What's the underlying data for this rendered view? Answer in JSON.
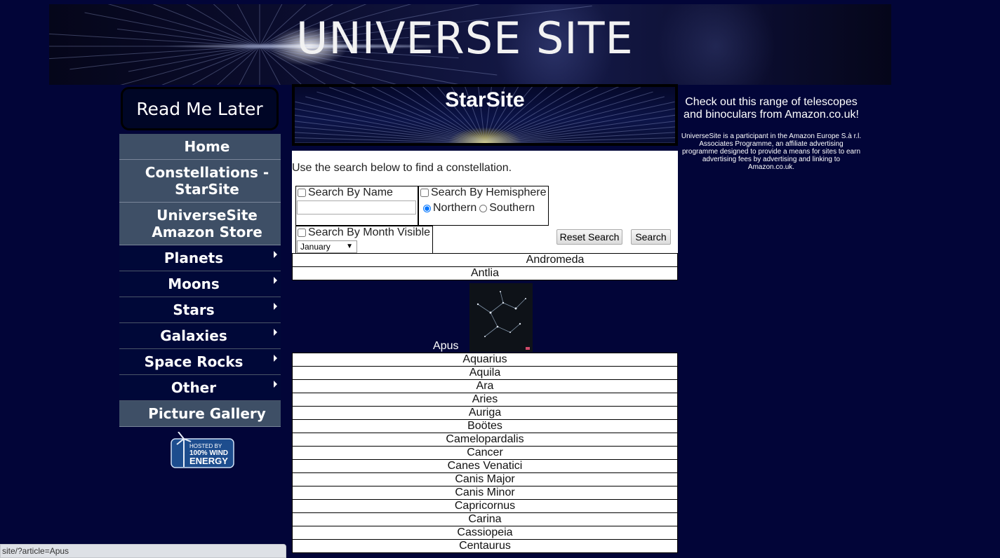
{
  "banner": {
    "title": "UNIVERSE SITE"
  },
  "sidebar": {
    "read_me_later": "Read Me Later",
    "items": [
      {
        "label": "Home",
        "style": "light",
        "submenu": false
      },
      {
        "label": "Constellations - StarSite",
        "style": "light",
        "submenu": false
      },
      {
        "label": "UniverseSite Amazon Store",
        "style": "light",
        "submenu": false
      },
      {
        "label": "Planets",
        "style": "dark",
        "submenu": true
      },
      {
        "label": "Moons",
        "style": "dark",
        "submenu": true
      },
      {
        "label": "Stars",
        "style": "dark",
        "submenu": true
      },
      {
        "label": "Galaxies",
        "style": "dark",
        "submenu": true
      },
      {
        "label": "Space Rocks",
        "style": "dark",
        "submenu": true
      },
      {
        "label": "Other",
        "style": "dark",
        "submenu": true
      },
      {
        "label": "Picture Gallery",
        "style": "light",
        "submenu": false
      }
    ],
    "badge": {
      "line1": "HOSTED BY",
      "line2": "100% WIND",
      "line3": "ENERGY"
    }
  },
  "main": {
    "header_title": "StarSite",
    "intro": "Use the search below to find a constellation.",
    "search": {
      "by_name_label": "Search By Name",
      "name_value": "",
      "by_hemisphere_label": "Search By Hemisphere",
      "hemisphere_options": [
        "Northern",
        "Southern"
      ],
      "hemisphere_selected": "Northern",
      "by_month_label": "Search By Month Visible",
      "month_selected": "January",
      "reset_label": "Reset Search",
      "search_label": "Search"
    },
    "constellations_before": [
      "Andromeda",
      "Antlia"
    ],
    "hovered": "Apus",
    "constellations_after": [
      "Aquarius",
      "Aquila",
      "Ara",
      "Aries",
      "Auriga",
      "Boötes",
      "Camelopardalis",
      "Cancer",
      "Canes Venatici",
      "Canis Major",
      "Canis Minor",
      "Capricornus",
      "Carina",
      "Cassiopeia",
      "Centaurus"
    ]
  },
  "right": {
    "heading": "Check out this range of telescopes and binoculars from Amazon.co.uk!",
    "disclaimer": "UniverseSite is a participant in the Amazon Europe S.à r.l. Associates Programme, an affiliate advertising programme designed to provide a means for sites to earn advertising fees by advertising and linking to Amazon.co.uk."
  },
  "status_bar": {
    "url": "site/?article=Apus"
  },
  "colors": {
    "background": "#020538",
    "nav_light": "#3e4f66",
    "nav_dark": "#000838"
  }
}
